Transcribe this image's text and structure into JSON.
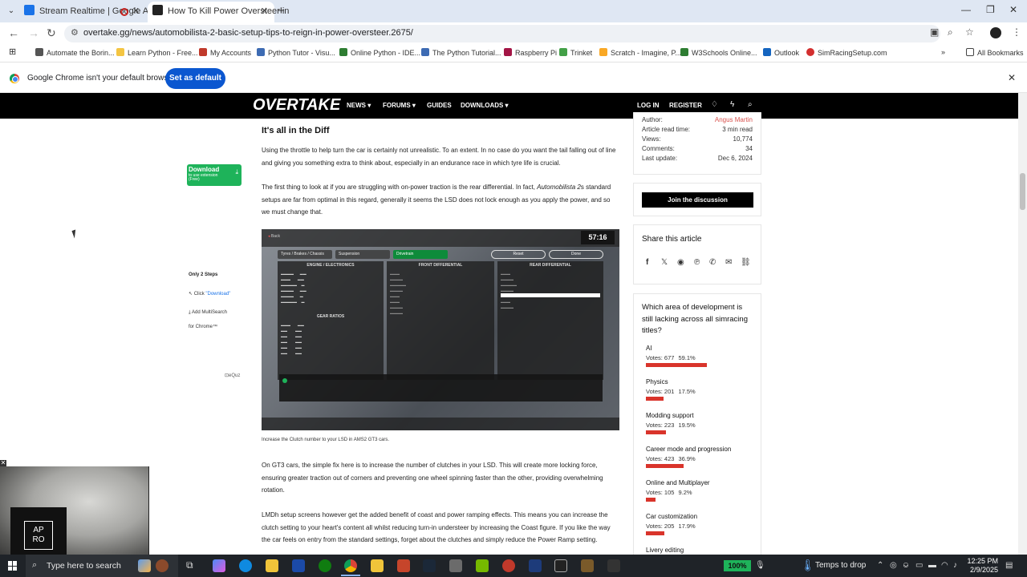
{
  "browser": {
    "tabs": [
      {
        "title": "Stream Realtime | Google A",
        "active": false
      },
      {
        "title": "How To Kill Power Oversteer in",
        "active": true
      }
    ],
    "url": "overtake.gg/news/automobilista-2-basic-setup-tips-to-reign-in-power-oversteer.2675/",
    "bookmarks": [
      "Automate the Borin...",
      "Learn Python - Free...",
      "My Accounts",
      "Python Tutor - Visu...",
      "Online Python - IDE...",
      "The Python Tutorial...",
      "Raspberry Pi",
      "Trinket",
      "Scratch - Imagine, P...",
      "W3Schools Online...",
      "Outlook",
      "SimRacingSetup.com"
    ],
    "all_bookmarks": "All Bookmarks",
    "infobar": {
      "text": "Google Chrome isn't your default browser",
      "button": "Set as default"
    }
  },
  "site": {
    "logo": "OVERTAKE",
    "nav": [
      "NEWS",
      "FORUMS",
      "GUIDES",
      "DOWNLOADS"
    ],
    "login": "LOG IN",
    "register": "REGISTER"
  },
  "ad": {
    "download": "Download",
    "download_sub": "to use extension (Free)",
    "steps_title": "Only 2 Steps",
    "step1_prefix": "Click ",
    "step1_link": "\"Download\"",
    "step2": "Add MultiSearch",
    "step2b": "for Chrome™",
    "brand": "eQuz"
  },
  "article": {
    "heading": "It's all in the Diff",
    "p1": "Using the throttle to help turn the car is certainly not unrealistic. To an extent. In no case do you want the tail falling out of line and giving you something extra to think about, especially in an endurance race in which tyre life is crucial.",
    "p2a": "The first thing to look at if you are struggling with on-power traction is the rear differential. In fact, ",
    "p2em": "Automobilista 2",
    "p2b": "s standard setups are far from optimal in this regard, generally it seems the LSD does not lock enough as you apply the power, and so we must change that.",
    "caption": "Increase the Clutch number to your LSD in AMS2 GT3 cars.",
    "p3": "On GT3 cars, the simple fix here is to increase the number of clutches in your LSD. This will create more locking force, ensuring greater traction out of corners and preventing one wheel spinning faster than the other, providing overwhelming rotation.",
    "p4": "LMDh setup screens however get the added benefit of coast and power ramping effects. This means you can increase the clutch setting to your heart's content all whilst reducing turn-in understeer by increasing the Coast figure. If you like the way the car feels on entry from the standard settings, forget about the clutches and simply reduce the Power Ramp setting."
  },
  "game_ui": {
    "timer": "57:16",
    "tabs": [
      "Tyres / Brakes / Chassis",
      "Suspension",
      "Drivetrain"
    ],
    "buttons": [
      "Reset",
      "Done"
    ],
    "panels": [
      "ENGINE / ELECTRONICS",
      "FRONT DIFFERENTIAL",
      "REAR DIFFERENTIAL"
    ],
    "gear_ratios": "GEAR RATIOS",
    "back": "Back"
  },
  "meta": {
    "author_label": "Author:",
    "author": "Angus Martin",
    "read_time_label": "Article read time:",
    "read_time": "3 min read",
    "views_label": "Views:",
    "views": "10,774",
    "comments_label": "Comments:",
    "comments": "34",
    "last_update_label": "Last update:",
    "last_update": "Dec 6, 2024"
  },
  "join": "Join the discussion",
  "share": {
    "title": "Share this article",
    "icons": [
      "facebook-icon",
      "x-icon",
      "reddit-icon",
      "pinterest-icon",
      "whatsapp-icon",
      "email-icon",
      "link-icon"
    ]
  },
  "poll": {
    "question": "Which area of development is still lacking across all simracing titles?",
    "options": [
      {
        "label": "AI",
        "votes": "Votes: 677",
        "pct": "59.1%",
        "fraction": 0.591
      },
      {
        "label": "Physics",
        "votes": "Votes: 201",
        "pct": "17.5%",
        "fraction": 0.175
      },
      {
        "label": "Modding support",
        "votes": "Votes: 223",
        "pct": "19.5%",
        "fraction": 0.195
      },
      {
        "label": "Career mode and progression",
        "votes": "Votes: 423",
        "pct": "36.9%",
        "fraction": 0.369
      },
      {
        "label": "Online and Multiplayer",
        "votes": "Votes: 105",
        "pct": "9.2%",
        "fraction": 0.092
      },
      {
        "label": "Car customization",
        "votes": "Votes: 205",
        "pct": "17.9%",
        "fraction": 0.179
      },
      {
        "label": "Livery editing",
        "votes": "",
        "pct": "",
        "fraction": 0
      }
    ]
  },
  "webcam": {
    "badge_line1": "AP",
    "badge_line2": "RO"
  },
  "taskbar": {
    "search_placeholder": "Type here to search",
    "battery": "100%",
    "weather": "Temps to drop",
    "time": "12:25 PM",
    "date": "2/9/2025"
  },
  "colors": {
    "accent_green": "#1eb35a",
    "poll_red": "#d9342b",
    "chrome_blue": "#0b57d0"
  }
}
